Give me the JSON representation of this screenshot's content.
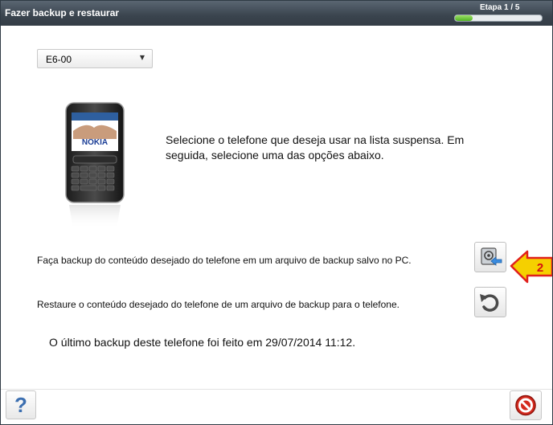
{
  "window": {
    "title": "Fazer backup e restaurar"
  },
  "wizard": {
    "step_label": "Etapa 1 / 5",
    "progress_fraction": 0.2
  },
  "device_select": {
    "selected": "E6-00"
  },
  "phone_image": {
    "brand": "NOKIA"
  },
  "instruction_text": "Selecione o telefone que deseja usar na lista suspensa. Em seguida, selecione uma das opções abaixo.",
  "backup_option": {
    "label": "Faça backup do conteúdo desejado do telefone em um arquivo de backup salvo no PC.",
    "icon": "backup-to-pc-icon"
  },
  "restore_option": {
    "label": "Restaure o conteúdo desejado do telefone de um arquivo de backup para o telefone.",
    "icon": "restore-icon"
  },
  "last_backup_text": "O último backup deste telefone foi feito em 29/07/2014 11:12.",
  "annotation": {
    "number": "2",
    "color": "#f5d000"
  },
  "footer": {
    "help_label": "?",
    "help_icon": "help-icon",
    "cancel_icon": "cancel-icon"
  }
}
